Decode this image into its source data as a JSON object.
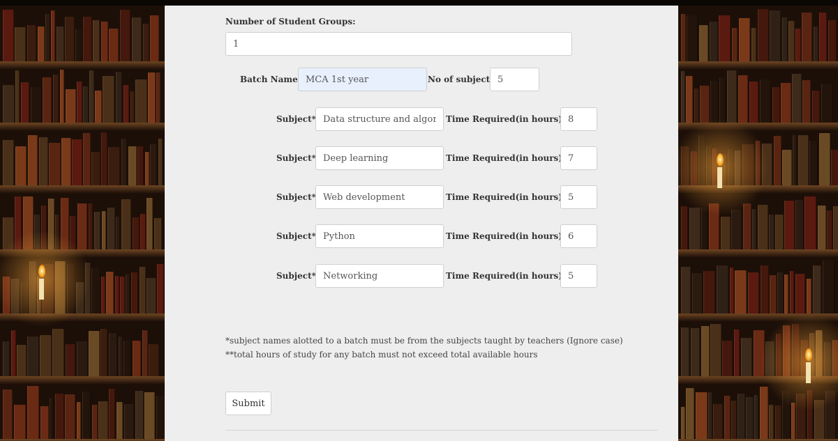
{
  "form": {
    "groups_label": "Number of Student Groups:",
    "groups_value": "1",
    "batch_label": "Batch Name:",
    "batch_value": "MCA 1st year",
    "subjects_count_label": "No of subjects:",
    "subjects_count_value": "5",
    "subject_label": "Subject*:",
    "time_label": "Time Required(in hours)**:",
    "rows": [
      {
        "subject": "Data structure and algorithms",
        "hours": "8"
      },
      {
        "subject": "Deep learning",
        "hours": "7"
      },
      {
        "subject": "Web development",
        "hours": "5"
      },
      {
        "subject": "Python",
        "hours": "6"
      },
      {
        "subject": "Networking",
        "hours": "5"
      }
    ],
    "note1": "*subject names alotted to a batch must be from the subjects taught by teachers (Ignore case)",
    "note2": "**total hours of study for any batch must not exceed total available hours",
    "submit_label": "Submit"
  },
  "colors": {
    "panel_bg": "#eeeeee",
    "highlight_input": "#e8f0fe"
  }
}
